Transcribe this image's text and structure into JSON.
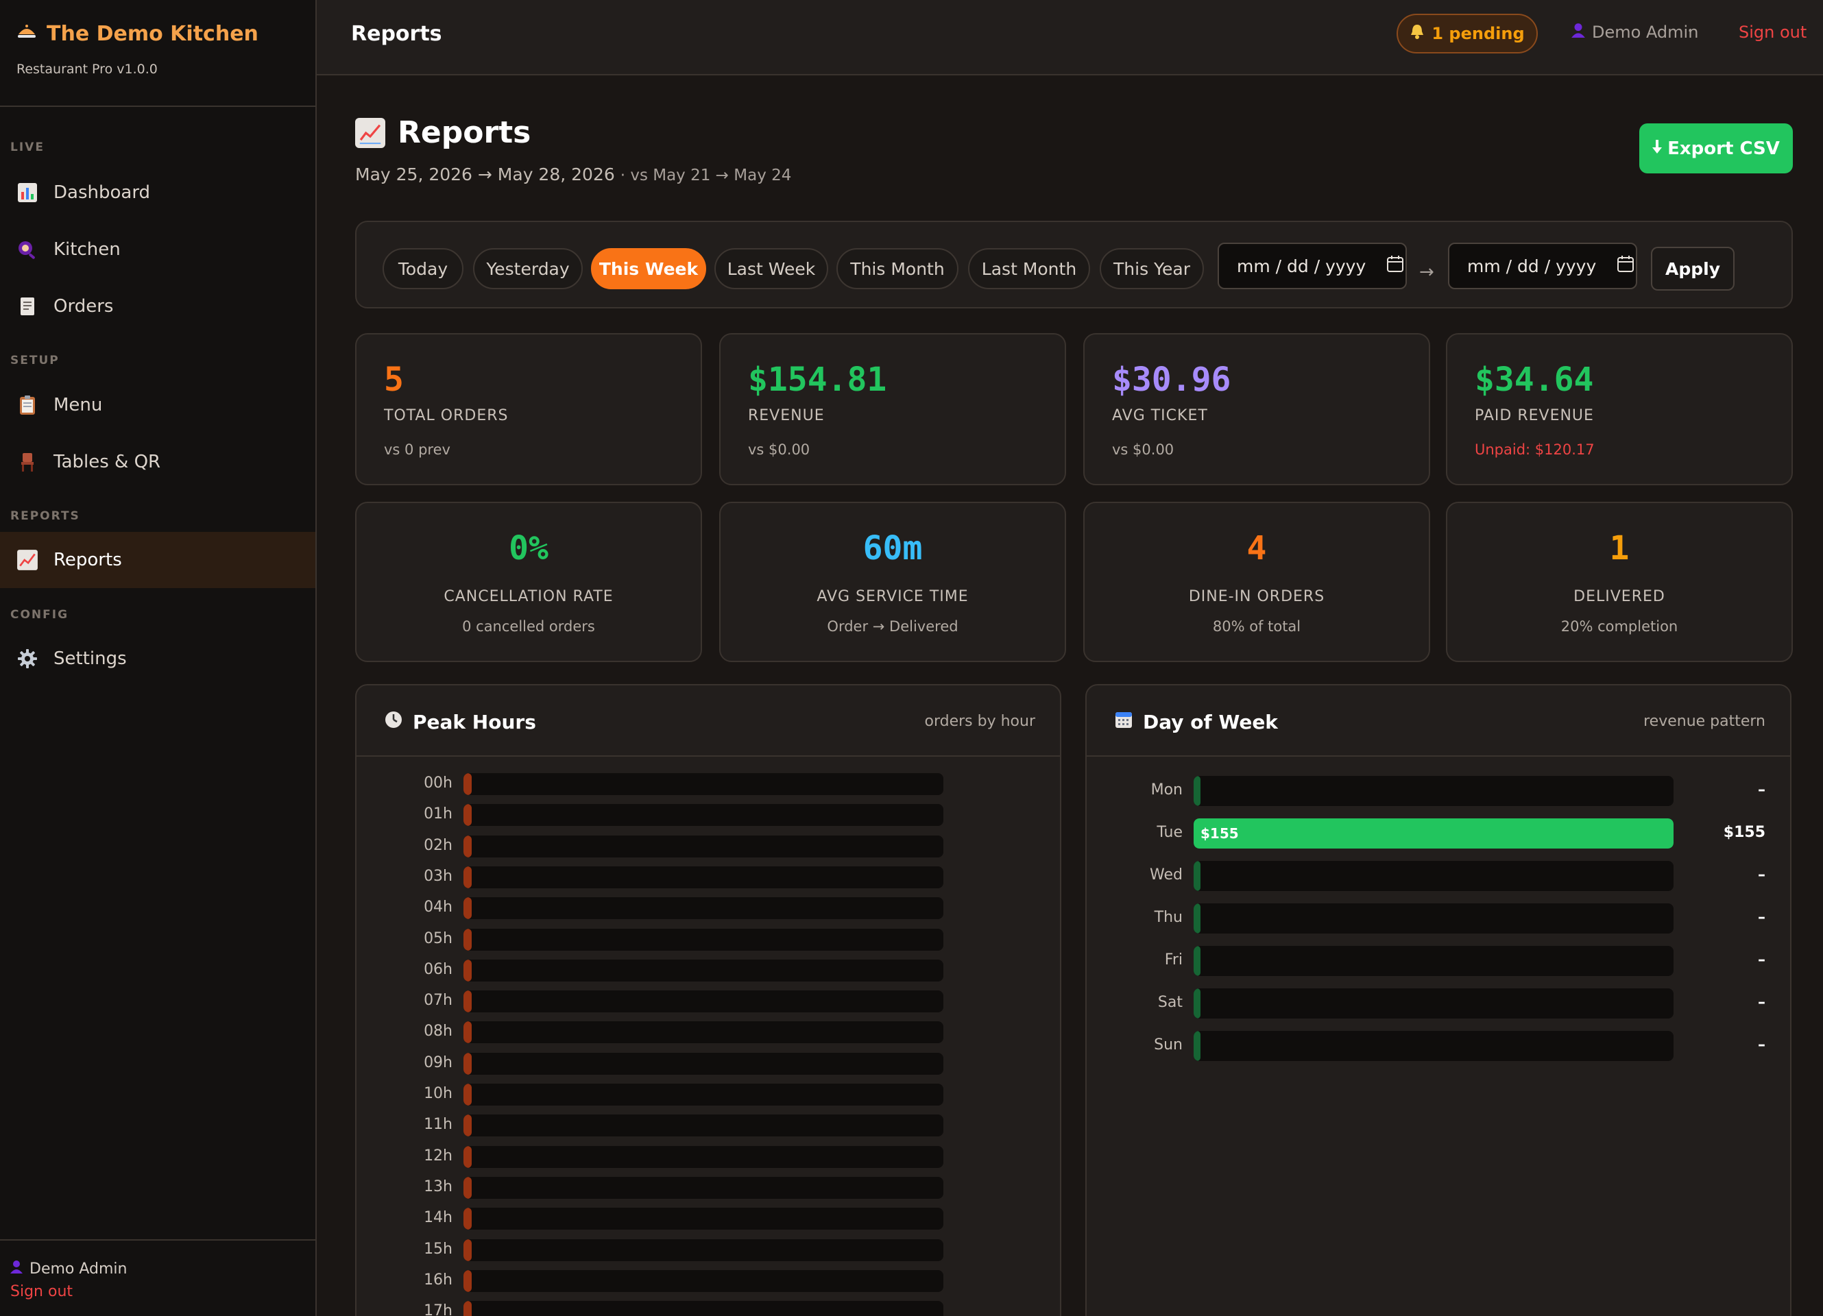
{
  "brand": {
    "name": "The Demo Kitchen",
    "version": "Restaurant Pro v1.0.0"
  },
  "sidebar": {
    "sections": {
      "live": "LIVE",
      "setup": "SETUP",
      "reports": "REPORTS",
      "config": "CONFIG"
    },
    "items": [
      {
        "label": "Dashboard",
        "icon": "bar-chart-icon"
      },
      {
        "label": "Kitchen",
        "icon": "pan-icon"
      },
      {
        "label": "Orders",
        "icon": "receipt-icon"
      },
      {
        "label": "Menu",
        "icon": "clipboard-icon"
      },
      {
        "label": "Tables & QR",
        "icon": "chair-icon"
      },
      {
        "label": "Reports",
        "icon": "chart-up-icon",
        "active": true
      },
      {
        "label": "Settings",
        "icon": "gear-icon"
      }
    ],
    "footer": {
      "user": "Demo Admin",
      "signout": "Sign out"
    }
  },
  "header": {
    "title": "Reports",
    "pending": "1 pending",
    "user": "Demo Admin",
    "separator": "·",
    "signout": "Sign out"
  },
  "page": {
    "title": "Reports",
    "range": "May 25, 2026 → May 28, 2026",
    "compare": "· vs May 21 → May 24",
    "export_label": "Export CSV"
  },
  "filters": {
    "presets": [
      "Today",
      "Yesterday",
      "This Week",
      "Last Week",
      "This Month",
      "Last Month",
      "This Year"
    ],
    "active": "This Week",
    "from_placeholder": "mm / dd / yyyy",
    "to_placeholder": "mm / dd / yyyy",
    "arrow": "→",
    "apply_label": "Apply"
  },
  "stats_top": [
    {
      "value": "5",
      "label": "TOTAL ORDERS",
      "sub": "vs 0 prev",
      "color": "#f97316",
      "sub_color": "#b2aaa2"
    },
    {
      "value": "$154.81",
      "label": "REVENUE",
      "sub": "vs $0.00",
      "color": "#22c55e",
      "sub_color": "#b2aaa2"
    },
    {
      "value": "$30.96",
      "label": "AVG TICKET",
      "sub": "vs $0.00",
      "color": "#a78bfa",
      "sub_color": "#b2aaa2"
    },
    {
      "value": "$34.64",
      "label": "PAID REVENUE",
      "sub": "Unpaid: $120.17",
      "color": "#22c55e",
      "sub_color": "#ef4444"
    }
  ],
  "stats_bottom": [
    {
      "value": "0%",
      "label": "CANCELLATION RATE",
      "sub": "0 cancelled orders",
      "color": "#22c55e"
    },
    {
      "value": "60m",
      "label": "AVG SERVICE TIME",
      "sub": "Order → Delivered",
      "color": "#38bdf8"
    },
    {
      "value": "4",
      "label": "DINE-IN ORDERS",
      "sub": "80% of total",
      "color": "#f97316"
    },
    {
      "value": "1",
      "label": "DELIVERED",
      "sub": "20% completion",
      "color": "#f59e0b"
    }
  ],
  "peak_hours": {
    "title": "Peak Hours",
    "subtitle": "orders by hour",
    "hours": [
      "00h",
      "01h",
      "02h",
      "03h",
      "04h",
      "05h",
      "06h",
      "07h",
      "08h",
      "09h",
      "10h",
      "11h",
      "12h",
      "13h",
      "14h",
      "15h",
      "16h",
      "17h"
    ],
    "orders": [
      0,
      0,
      0,
      0,
      0,
      0,
      0,
      0,
      0,
      0,
      0,
      0,
      0,
      0,
      0,
      0,
      0,
      0
    ]
  },
  "day_of_week": {
    "title": "Day of Week",
    "subtitle": "revenue pattern",
    "days": [
      "Mon",
      "Tue",
      "Wed",
      "Thu",
      "Fri",
      "Sat",
      "Sun"
    ],
    "revenue": [
      0,
      155,
      0,
      0,
      0,
      0,
      0
    ],
    "bar_labels": [
      "",
      "$155",
      "",
      "",
      "",
      "",
      ""
    ],
    "value_labels": [
      "–",
      "$155",
      "–",
      "–",
      "–",
      "–",
      "–"
    ]
  },
  "colors": {
    "accent": "#f97316",
    "success": "#22c55e",
    "danger": "#ef4444",
    "hour_bar": "#9a3412",
    "day_bar": "#166534"
  }
}
